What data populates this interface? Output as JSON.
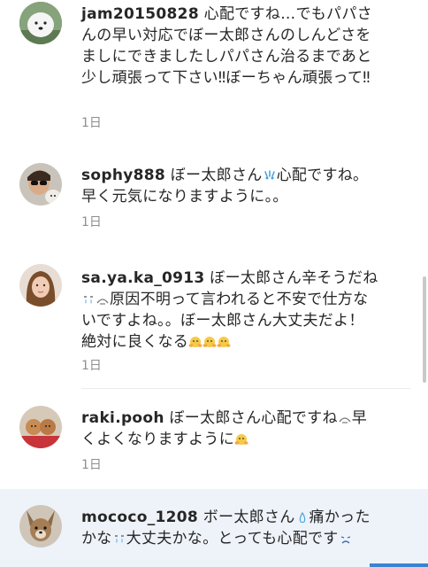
{
  "comments": [
    {
      "username": "jam20150828",
      "text": " 心配ですね…でもパパさんの早い対応でぼー太郎さんのしんどさをましにできましたしパパさん治るまであと少し頑張って下さい‼︎ぼーちゃん頑張って‼︎",
      "time": "1日"
    },
    {
      "username": "sophy888",
      "text_a": " ぼー太郎さん",
      "text_b": "心配ですね。早く元気になりますように。。",
      "time": "1日"
    },
    {
      "username": "sa.ya.ka_0913",
      "text_a": " ぼー太郎さん辛そうだね",
      "text_b": "原因不明って言われると不安で仕方ないですよね。。ぼー太郎さん大丈夫だよ！絶対に良くなる",
      "time": "1日"
    },
    {
      "username": "raki.pooh",
      "text_a": " ぼー太郎さん心配ですね",
      "text_b": "早くよくなりますように",
      "time": "1日"
    },
    {
      "username": "mococo_1208",
      "text_a": " ボー太郎さん",
      "text_b": "痛かったかな",
      "text_c": "大丈夫かな。とっても心配です"
    }
  ],
  "icons": [
    "avatar-samoyed",
    "avatar-sunglasses",
    "avatar-woman",
    "avatar-poodles",
    "avatar-chihuahua",
    "sweat-emoji",
    "tear-emoji",
    "hug-emoji",
    "sad-face-emoji"
  ],
  "colors": {
    "time": "#8e8e8e",
    "highlight": "#eef3fa",
    "accent": "#3a82d4"
  }
}
